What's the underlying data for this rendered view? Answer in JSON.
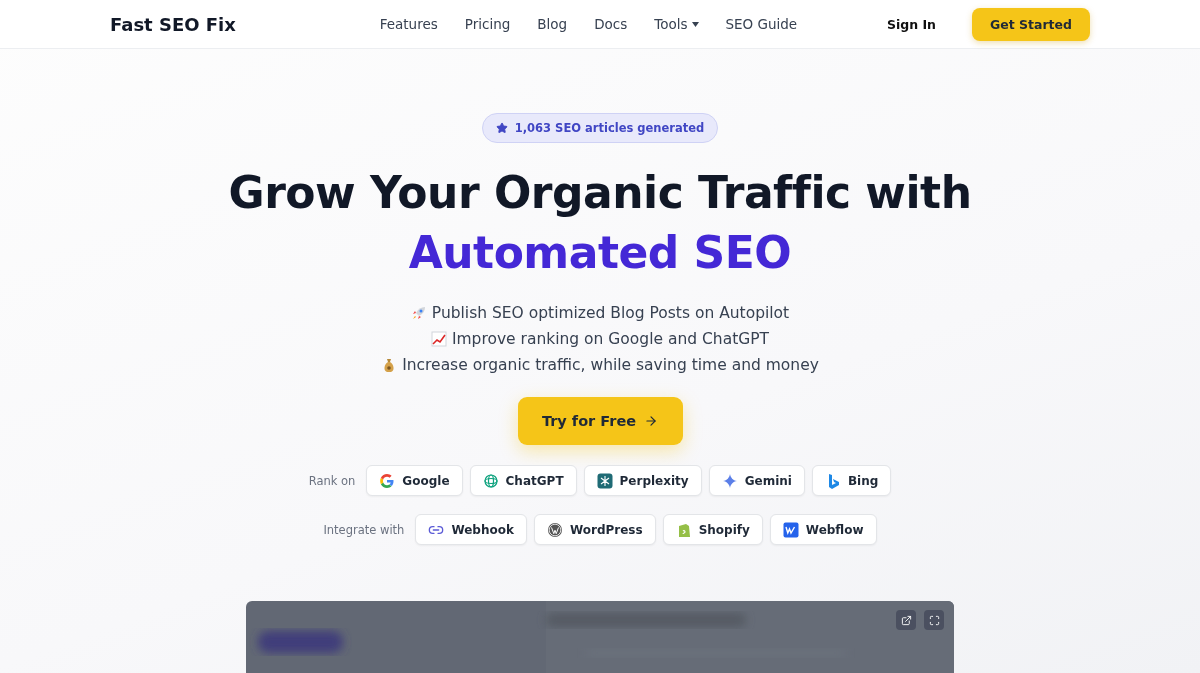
{
  "nav": {
    "logo": "Fast SEO Fix",
    "links": [
      {
        "label": "Features",
        "dropdown": false
      },
      {
        "label": "Pricing",
        "dropdown": false
      },
      {
        "label": "Blog",
        "dropdown": false
      },
      {
        "label": "Docs",
        "dropdown": false
      },
      {
        "label": "Tools",
        "dropdown": true
      },
      {
        "label": "SEO Guide",
        "dropdown": false
      }
    ],
    "sign_in": "Sign In",
    "cta": "Get Started"
  },
  "hero": {
    "badge": "1,063 SEO articles generated",
    "title_line1": "Grow Your Organic Traffic with",
    "title_line2": "Automated SEO",
    "bullets": [
      {
        "kind": "rocket",
        "text": "Publish SEO optimized Blog Posts on Autopilot"
      },
      {
        "kind": "chart",
        "text": "Improve ranking on Google and ChatGPT"
      },
      {
        "kind": "moneybag",
        "text": "Increase organic traffic, while saving time and money"
      }
    ],
    "cta": "Try for Free",
    "rank_label": "Rank on",
    "rank_on": [
      {
        "kind": "google",
        "label": "Google"
      },
      {
        "kind": "chatgpt",
        "label": "ChatGPT"
      },
      {
        "kind": "perplexity",
        "label": "Perplexity"
      },
      {
        "kind": "gemini",
        "label": "Gemini"
      },
      {
        "kind": "bing",
        "label": "Bing"
      }
    ],
    "integrate_label": "Integrate with",
    "integrations": [
      {
        "kind": "webhook",
        "label": "Webhook"
      },
      {
        "kind": "wordpress",
        "label": "WordPress"
      },
      {
        "kind": "shopify",
        "label": "Shopify"
      },
      {
        "kind": "webflow",
        "label": "Webflow"
      }
    ]
  }
}
